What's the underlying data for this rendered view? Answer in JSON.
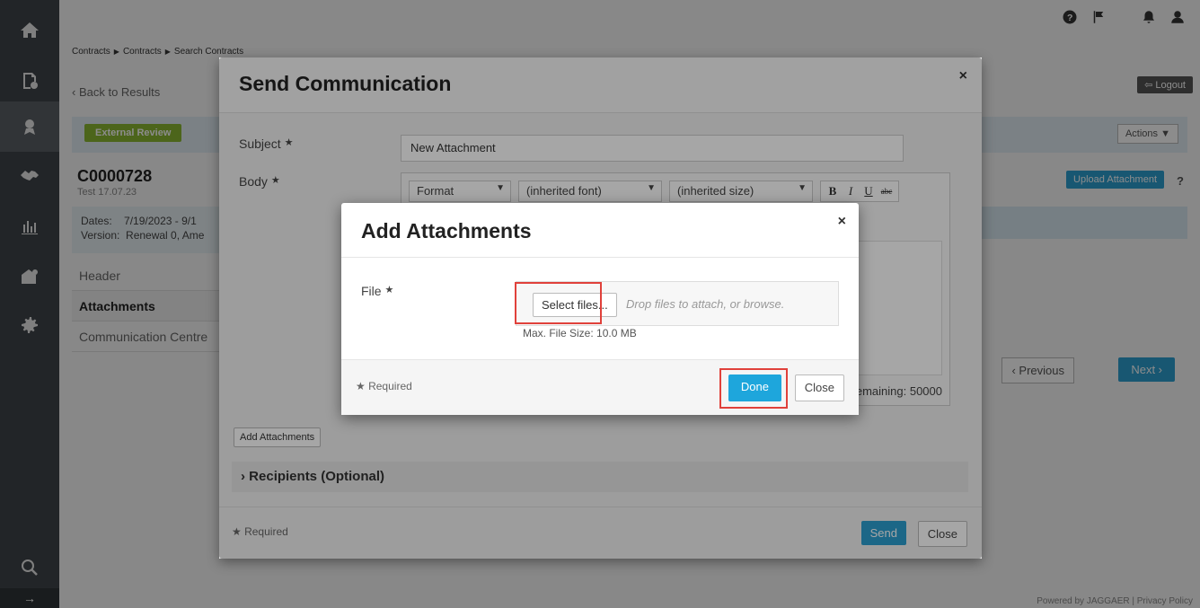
{
  "breadcrumb": [
    "Contracts",
    "Contracts",
    "Search Contracts"
  ],
  "back_link": "‹ Back to Results",
  "logout": "Logout",
  "status_badge": "External Review",
  "actions_label": "Actions",
  "contract": {
    "id": "C0000728",
    "subtitle": "Test 17.07.23",
    "dates_label": "Dates:",
    "dates_value": "7/19/2023 - 9/1",
    "version_label": "Version:",
    "version_value": "Renewal 0, Ame"
  },
  "left_nav": [
    "Header",
    "Attachments",
    "Communication Centre"
  ],
  "upload_attachment": "Upload Attachment",
  "help_mark": "?",
  "prev_label": "‹ Previous",
  "next_label": "Next ›",
  "footer_text": "Powered by JAGGAER | Privacy Policy",
  "send_modal": {
    "title": "Send Communication",
    "subject_label": "Subject",
    "subject_value": "New Attachment",
    "body_label": "Body",
    "toolbar": {
      "format": "Format",
      "font": "(inherited font)",
      "size": "(inherited size)",
      "bold": "B",
      "italic": "I",
      "underline": "U",
      "strike": "abc"
    },
    "char_remaining": "emaining: 50000",
    "add_attachments": "Add Attachments",
    "recipients": "Recipients (Optional)",
    "required": "Required",
    "send": "Send",
    "close": "Close"
  },
  "attach_modal": {
    "title": "Add Attachments",
    "file_label": "File",
    "select_files": "Select files...",
    "drop_hint": "Drop files to attach, or browse.",
    "max_size": "Max. File Size: 10.0 MB",
    "required": "Required",
    "done": "Done",
    "close": "Close"
  },
  "colors": {
    "sidebar": "#3f4449",
    "primary_button": "#1ea6dc",
    "status_badge": "#8ab832",
    "highlight": "#e0413b"
  }
}
